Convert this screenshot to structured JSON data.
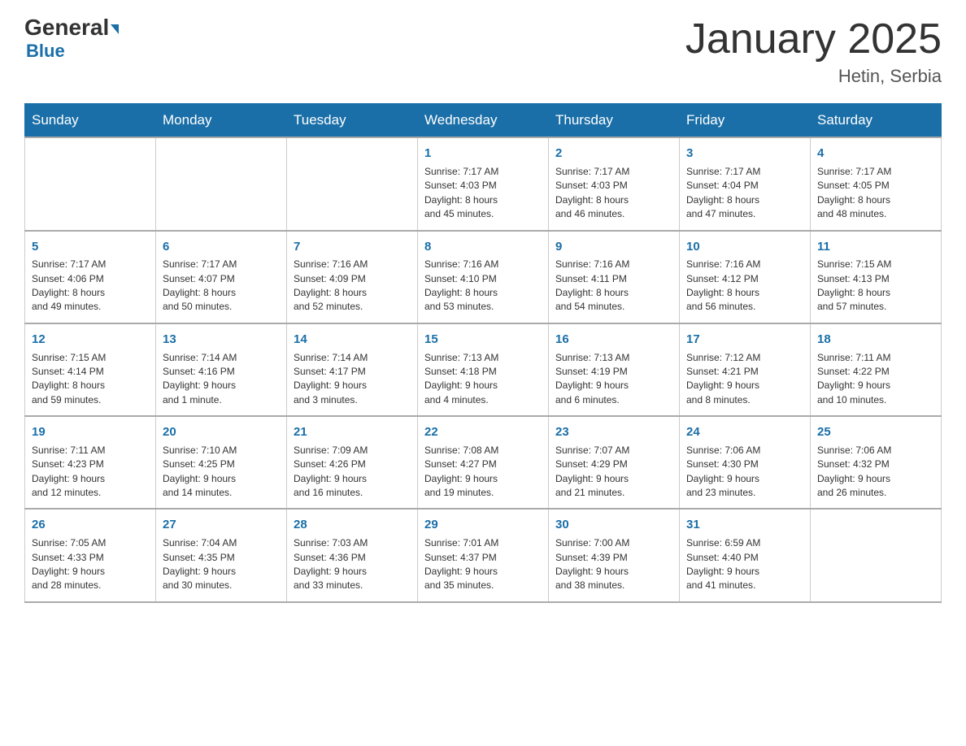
{
  "header": {
    "logo_general": "General",
    "logo_blue": "Blue",
    "month_title": "January 2025",
    "location": "Hetin, Serbia"
  },
  "days_of_week": [
    "Sunday",
    "Monday",
    "Tuesday",
    "Wednesday",
    "Thursday",
    "Friday",
    "Saturday"
  ],
  "weeks": [
    [
      {
        "day": "",
        "info": ""
      },
      {
        "day": "",
        "info": ""
      },
      {
        "day": "",
        "info": ""
      },
      {
        "day": "1",
        "info": "Sunrise: 7:17 AM\nSunset: 4:03 PM\nDaylight: 8 hours\nand 45 minutes."
      },
      {
        "day": "2",
        "info": "Sunrise: 7:17 AM\nSunset: 4:03 PM\nDaylight: 8 hours\nand 46 minutes."
      },
      {
        "day": "3",
        "info": "Sunrise: 7:17 AM\nSunset: 4:04 PM\nDaylight: 8 hours\nand 47 minutes."
      },
      {
        "day": "4",
        "info": "Sunrise: 7:17 AM\nSunset: 4:05 PM\nDaylight: 8 hours\nand 48 minutes."
      }
    ],
    [
      {
        "day": "5",
        "info": "Sunrise: 7:17 AM\nSunset: 4:06 PM\nDaylight: 8 hours\nand 49 minutes."
      },
      {
        "day": "6",
        "info": "Sunrise: 7:17 AM\nSunset: 4:07 PM\nDaylight: 8 hours\nand 50 minutes."
      },
      {
        "day": "7",
        "info": "Sunrise: 7:16 AM\nSunset: 4:09 PM\nDaylight: 8 hours\nand 52 minutes."
      },
      {
        "day": "8",
        "info": "Sunrise: 7:16 AM\nSunset: 4:10 PM\nDaylight: 8 hours\nand 53 minutes."
      },
      {
        "day": "9",
        "info": "Sunrise: 7:16 AM\nSunset: 4:11 PM\nDaylight: 8 hours\nand 54 minutes."
      },
      {
        "day": "10",
        "info": "Sunrise: 7:16 AM\nSunset: 4:12 PM\nDaylight: 8 hours\nand 56 minutes."
      },
      {
        "day": "11",
        "info": "Sunrise: 7:15 AM\nSunset: 4:13 PM\nDaylight: 8 hours\nand 57 minutes."
      }
    ],
    [
      {
        "day": "12",
        "info": "Sunrise: 7:15 AM\nSunset: 4:14 PM\nDaylight: 8 hours\nand 59 minutes."
      },
      {
        "day": "13",
        "info": "Sunrise: 7:14 AM\nSunset: 4:16 PM\nDaylight: 9 hours\nand 1 minute."
      },
      {
        "day": "14",
        "info": "Sunrise: 7:14 AM\nSunset: 4:17 PM\nDaylight: 9 hours\nand 3 minutes."
      },
      {
        "day": "15",
        "info": "Sunrise: 7:13 AM\nSunset: 4:18 PM\nDaylight: 9 hours\nand 4 minutes."
      },
      {
        "day": "16",
        "info": "Sunrise: 7:13 AM\nSunset: 4:19 PM\nDaylight: 9 hours\nand 6 minutes."
      },
      {
        "day": "17",
        "info": "Sunrise: 7:12 AM\nSunset: 4:21 PM\nDaylight: 9 hours\nand 8 minutes."
      },
      {
        "day": "18",
        "info": "Sunrise: 7:11 AM\nSunset: 4:22 PM\nDaylight: 9 hours\nand 10 minutes."
      }
    ],
    [
      {
        "day": "19",
        "info": "Sunrise: 7:11 AM\nSunset: 4:23 PM\nDaylight: 9 hours\nand 12 minutes."
      },
      {
        "day": "20",
        "info": "Sunrise: 7:10 AM\nSunset: 4:25 PM\nDaylight: 9 hours\nand 14 minutes."
      },
      {
        "day": "21",
        "info": "Sunrise: 7:09 AM\nSunset: 4:26 PM\nDaylight: 9 hours\nand 16 minutes."
      },
      {
        "day": "22",
        "info": "Sunrise: 7:08 AM\nSunset: 4:27 PM\nDaylight: 9 hours\nand 19 minutes."
      },
      {
        "day": "23",
        "info": "Sunrise: 7:07 AM\nSunset: 4:29 PM\nDaylight: 9 hours\nand 21 minutes."
      },
      {
        "day": "24",
        "info": "Sunrise: 7:06 AM\nSunset: 4:30 PM\nDaylight: 9 hours\nand 23 minutes."
      },
      {
        "day": "25",
        "info": "Sunrise: 7:06 AM\nSunset: 4:32 PM\nDaylight: 9 hours\nand 26 minutes."
      }
    ],
    [
      {
        "day": "26",
        "info": "Sunrise: 7:05 AM\nSunset: 4:33 PM\nDaylight: 9 hours\nand 28 minutes."
      },
      {
        "day": "27",
        "info": "Sunrise: 7:04 AM\nSunset: 4:35 PM\nDaylight: 9 hours\nand 30 minutes."
      },
      {
        "day": "28",
        "info": "Sunrise: 7:03 AM\nSunset: 4:36 PM\nDaylight: 9 hours\nand 33 minutes."
      },
      {
        "day": "29",
        "info": "Sunrise: 7:01 AM\nSunset: 4:37 PM\nDaylight: 9 hours\nand 35 minutes."
      },
      {
        "day": "30",
        "info": "Sunrise: 7:00 AM\nSunset: 4:39 PM\nDaylight: 9 hours\nand 38 minutes."
      },
      {
        "day": "31",
        "info": "Sunrise: 6:59 AM\nSunset: 4:40 PM\nDaylight: 9 hours\nand 41 minutes."
      },
      {
        "day": "",
        "info": ""
      }
    ]
  ]
}
